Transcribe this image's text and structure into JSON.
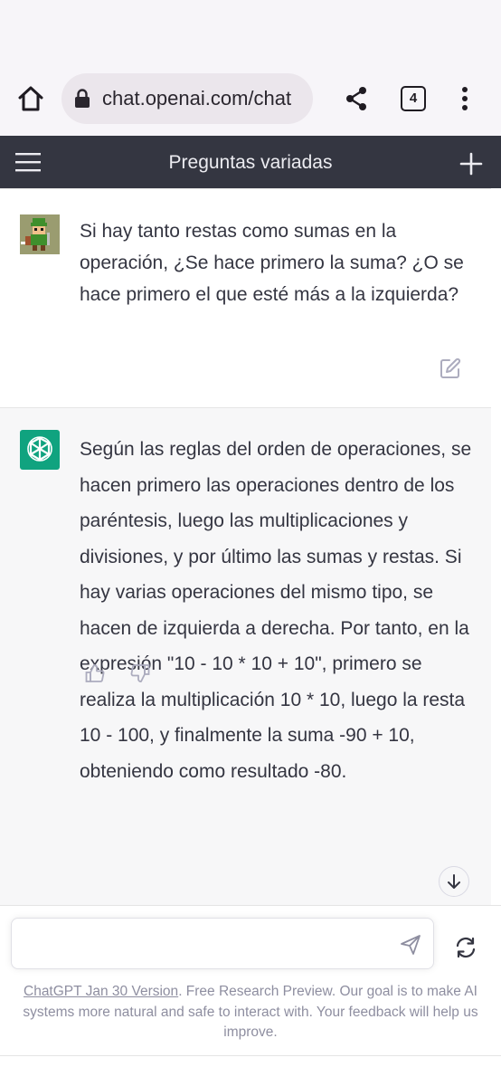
{
  "browser": {
    "url": "chat.openai.com/chat",
    "tab_count": "4",
    "icons": {
      "home": "home-icon",
      "lock": "lock-icon",
      "share": "share-icon",
      "menu": "more-vert-icon"
    }
  },
  "app_header": {
    "title": "Preguntas variadas",
    "background": "#343641",
    "icons": {
      "menu": "hamburger-icon",
      "new_chat": "plus-icon"
    }
  },
  "conversation": {
    "user_message": "Si hay tanto restas como sumas en la operación, ¿Se hace primero la suma? ¿O se hace primero el que esté más a la izquierda?",
    "assistant_message": "Según las reglas del orden de operaciones, se hacen primero las operaciones dentro de los paréntesis, luego las multiplicaciones y divisiones, y por último las sumas y restas. Si hay varias operaciones del mismo tipo, se hacen de izquierda a derecha. Por tanto, en la expresión \"10 - 10 * 10 + 10\", primero se realiza la multiplicación 10 * 10, luego la resta 10 - 100, y finalmente la suma -90 + 10, obteniendo como resultado -80.",
    "accent_color": "#10a37f",
    "icons": {
      "edit": "edit-icon",
      "thumbs_up": "thumbs-up-icon",
      "thumbs_down": "thumbs-down-icon",
      "scroll_down": "arrow-down-icon",
      "assistant_logo": "openai-logo-icon"
    }
  },
  "composer": {
    "input_value": "",
    "icons": {
      "send": "send-icon",
      "regenerate": "refresh-icon"
    }
  },
  "footer": {
    "version_link": "ChatGPT Jan 30 Version",
    "note": ". Free Research Preview. Our goal is to make AI systems more natural and safe to interact with. Your feedback will help us improve."
  }
}
